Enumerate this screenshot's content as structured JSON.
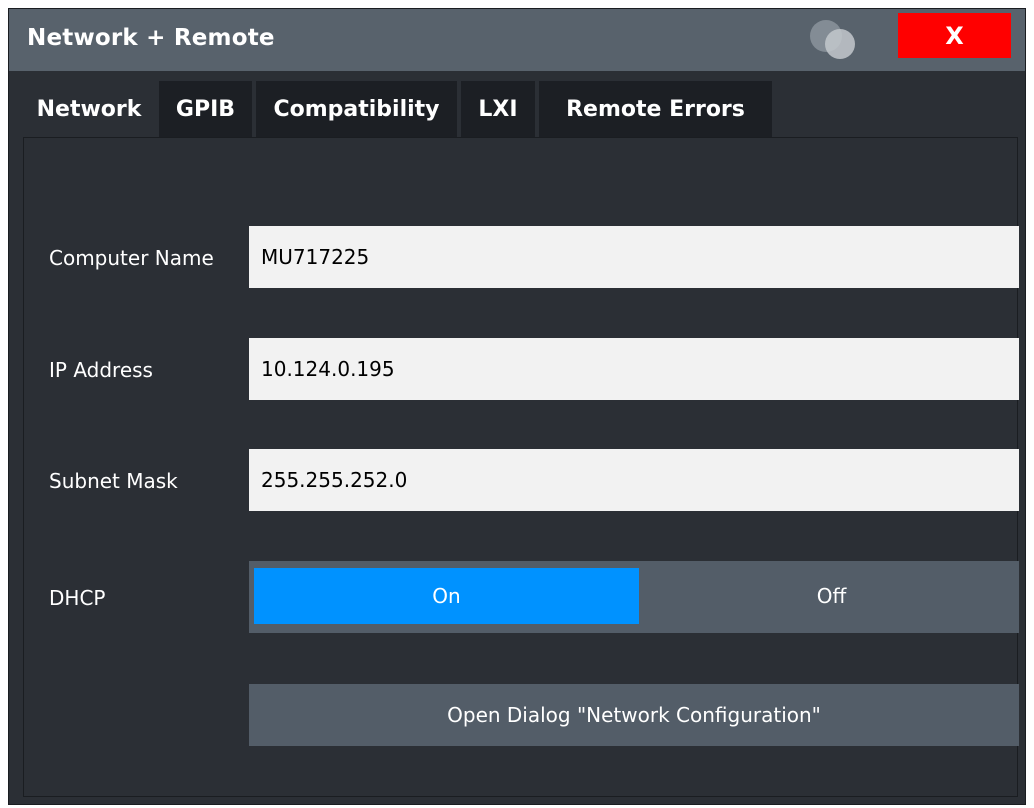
{
  "window": {
    "title": "Network + Remote",
    "close_label": "X",
    "help_icon": "bubble-icon",
    "close_color": "#ff0000"
  },
  "tabs": [
    {
      "label": "Network",
      "active": true
    },
    {
      "label": "GPIB",
      "active": false
    },
    {
      "label": "Compatibility",
      "active": false
    },
    {
      "label": "LXI",
      "active": false
    },
    {
      "label": "Remote Errors",
      "active": false
    }
  ],
  "network": {
    "computer_name": {
      "label": "Computer Name",
      "value": "MU717225"
    },
    "ip_address": {
      "label": "IP Address",
      "value": "10.124.0.195"
    },
    "subnet_mask": {
      "label": "Subnet Mask",
      "value": "255.255.252.0"
    },
    "dhcp": {
      "label": "DHCP",
      "on_label": "On",
      "off_label": "Off",
      "selected": "On",
      "selected_color": "#0092ff"
    },
    "open_dialog_label": "Open Dialog \"Network Configuration\""
  }
}
